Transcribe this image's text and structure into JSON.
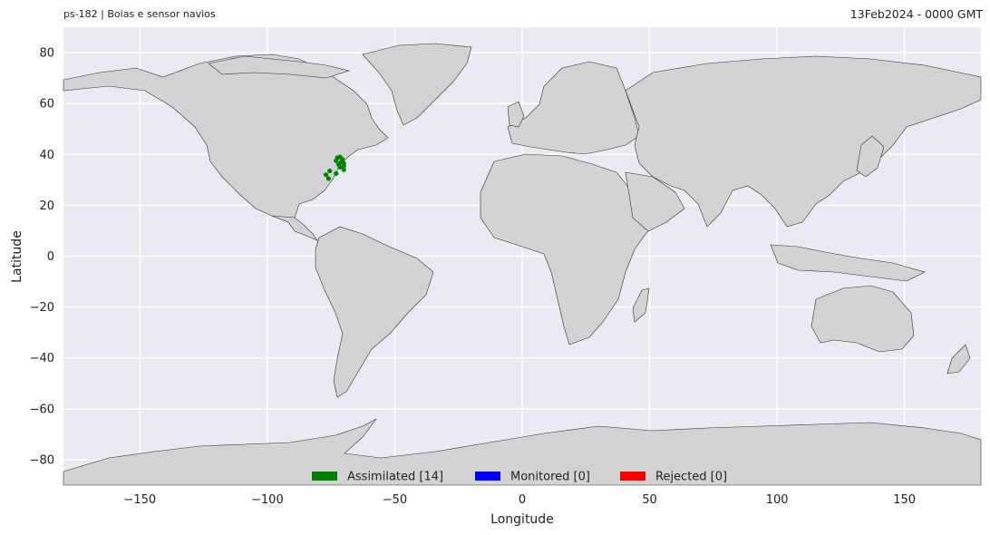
{
  "header": {
    "left_title": "ps-182  |  Boias e sensor navios",
    "right_title": "13Feb2024 - 0000 GMT"
  },
  "chart_data": {
    "type": "scatter",
    "projection": "equirectangular",
    "xlabel": "Longitude",
    "ylabel": "Latitude",
    "xlim": [
      -180,
      180
    ],
    "ylim": [
      -90,
      90
    ],
    "xticks": [
      -150,
      -100,
      -50,
      0,
      50,
      100,
      150
    ],
    "yticks": [
      80,
      60,
      40,
      20,
      0,
      -20,
      -40,
      -60,
      -80
    ],
    "grid": true,
    "legend_position": "bottom-center",
    "background_color": "#eaeaf2",
    "land_color": "#d3d3d3",
    "series": [
      {
        "name": "Assimilated [14]",
        "color": "#008000",
        "points": [
          {
            "lon": -72.5,
            "lat": 38.7
          },
          {
            "lon": -71.5,
            "lat": 39.0
          },
          {
            "lon": -70.5,
            "lat": 38.0
          },
          {
            "lon": -73.0,
            "lat": 37.5
          },
          {
            "lon": -71.0,
            "lat": 37.0
          },
          {
            "lon": -70.0,
            "lat": 36.5
          },
          {
            "lon": -72.0,
            "lat": 36.0
          },
          {
            "lon": -70.0,
            "lat": 35.5
          },
          {
            "lon": -71.5,
            "lat": 35.0
          },
          {
            "lon": -70.0,
            "lat": 34.0
          },
          {
            "lon": -75.5,
            "lat": 33.5
          },
          {
            "lon": -73.0,
            "lat": 32.5
          },
          {
            "lon": -77.0,
            "lat": 32.0
          },
          {
            "lon": -76.0,
            "lat": 30.5
          }
        ]
      },
      {
        "name": "Monitored [0]",
        "color": "#0000ff",
        "points": []
      },
      {
        "name": "Rejected [0]",
        "color": "#ff0000",
        "points": []
      }
    ]
  }
}
